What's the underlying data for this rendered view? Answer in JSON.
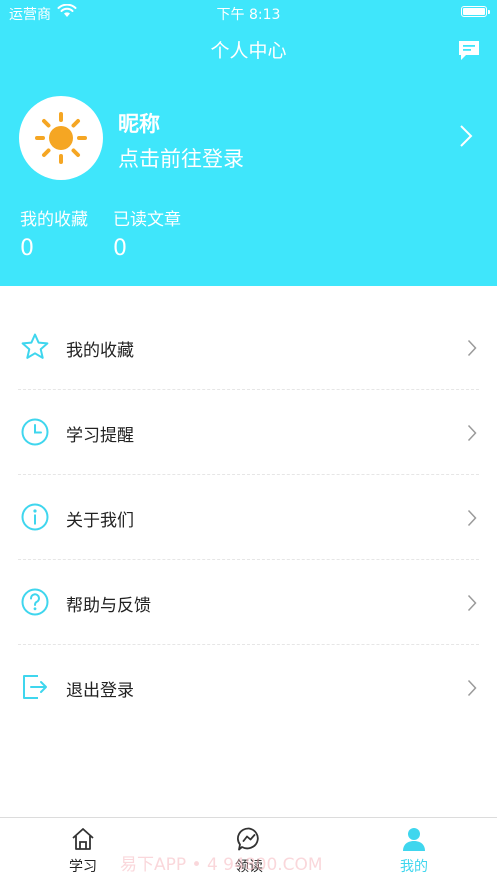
{
  "status_bar": {
    "carrier": "运营商",
    "time": "下午 8:13"
  },
  "nav": {
    "title": "个人中心"
  },
  "profile": {
    "nickname": "昵称",
    "login_hint": "点击前往登录"
  },
  "stats": {
    "favorites": {
      "label": "我的收藏",
      "value": "0"
    },
    "read": {
      "label": "已读文章",
      "value": "0"
    }
  },
  "menu": {
    "items": [
      {
        "label": "我的收藏",
        "icon": "star-icon"
      },
      {
        "label": "学习提醒",
        "icon": "clock-icon"
      },
      {
        "label": "关于我们",
        "icon": "info-icon"
      },
      {
        "label": "帮助与反馈",
        "icon": "help-icon"
      },
      {
        "label": "退出登录",
        "icon": "logout-icon"
      }
    ]
  },
  "tabbar": {
    "items": [
      {
        "label": "学习",
        "icon": "home-icon"
      },
      {
        "label": "领读",
        "icon": "chat-icon"
      },
      {
        "label": "我的",
        "icon": "user-icon"
      }
    ]
  },
  "watermark": "易下APP • 4 94800.COM",
  "colors": {
    "accent": "#3fe6fb",
    "tab_active": "#3fd6ee",
    "sun": "#f5a623"
  }
}
